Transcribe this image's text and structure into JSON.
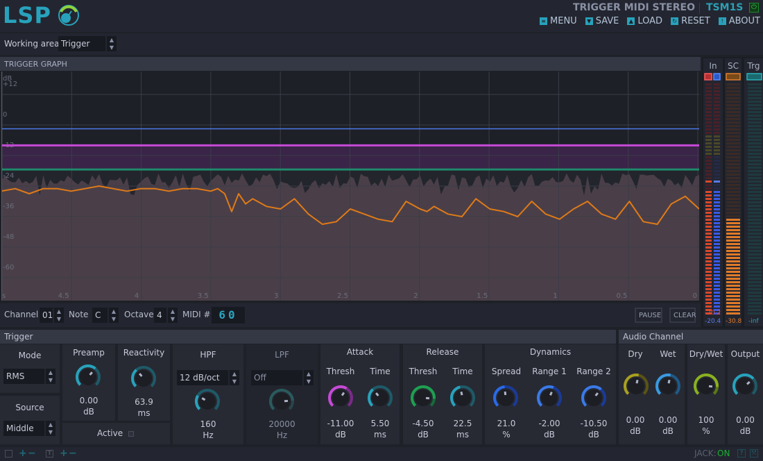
{
  "header": {
    "logo": "LSP",
    "title": "TRIGGER MIDI STEREO",
    "code": "TSM1S",
    "power_icon": "power-icon",
    "menu": [
      {
        "label": "MENU",
        "icon": "menu-icon"
      },
      {
        "label": "SAVE",
        "icon": "save-icon"
      },
      {
        "label": "LOAD",
        "icon": "load-icon"
      },
      {
        "label": "RESET",
        "icon": "reset-icon"
      },
      {
        "label": "ABOUT",
        "icon": "about-icon"
      }
    ]
  },
  "working_area": {
    "label": "Working area",
    "value": "Trigger"
  },
  "graph": {
    "title": "TRIGGER GRAPH",
    "y_unit": "dB",
    "y_ticks": [
      "+12",
      "0",
      "-12",
      "-24",
      "-36",
      "-48",
      "-60"
    ],
    "x_unit": "s",
    "x_ticks": [
      "4.5",
      "4",
      "3.5",
      "3",
      "2.5",
      "2",
      "1.5",
      "1",
      "0.5",
      "0"
    ],
    "colors": {
      "release_line": "#4a78e6",
      "attack_thresh": "#c64ad6",
      "attack_band": "#3a2448",
      "release_thresh": "#1e8a6a",
      "signal": "#e07a18",
      "area": "#4a3f48"
    }
  },
  "chart_data": {
    "type": "line",
    "title": "TRIGGER GRAPH",
    "xlabel": "s",
    "ylabel": "dB",
    "xlim": [
      5,
      0
    ],
    "ylim": [
      -72,
      18
    ],
    "horizontal_lines": [
      {
        "name": "release-level",
        "y": -4.5,
        "color": "#4a78e6"
      },
      {
        "name": "attack-threshold",
        "y": -11,
        "color": "#c64ad6"
      },
      {
        "name": "release-threshold",
        "y": -20.5,
        "color": "#1e8a6a"
      }
    ],
    "series": [
      {
        "name": "envelope",
        "color": "#e07a18",
        "x": [
          5,
          4.9,
          4.8,
          4.7,
          4.6,
          4.5,
          4.4,
          4.3,
          4.2,
          4.1,
          4.0,
          3.9,
          3.8,
          3.7,
          3.6,
          3.5,
          3.45,
          3.4,
          3.35,
          3.3,
          3.25,
          3.2,
          3.1,
          3.0,
          2.9,
          2.8,
          2.7,
          2.6,
          2.5,
          2.4,
          2.3,
          2.2,
          2.1,
          2.0,
          1.95,
          1.9,
          1.8,
          1.7,
          1.6,
          1.5,
          1.4,
          1.3,
          1.2,
          1.1,
          1.0,
          0.9,
          0.8,
          0.7,
          0.6,
          0.5,
          0.4,
          0.3,
          0.2,
          0.1,
          0.0
        ],
        "y": [
          -29,
          -28,
          -30,
          -28,
          -28,
          -29,
          -28,
          -27,
          -28,
          -29,
          -28,
          -28,
          -29,
          -28,
          -28,
          -29,
          -28,
          -30,
          -37,
          -30,
          -34,
          -32,
          -35,
          -36,
          -32,
          -38,
          -42,
          -41,
          -36,
          -38,
          -40,
          -41,
          -33,
          -36,
          -37,
          -35,
          -38,
          -39,
          -32,
          -36,
          -37,
          -39,
          -33,
          -38,
          -40,
          -36,
          -33,
          -38,
          -40,
          -33,
          -41,
          -42,
          -34,
          -31,
          -36
        ]
      },
      {
        "name": "input-signal-peak",
        "color": "#5a4f5c",
        "y_range_db": [
          -22,
          -28
        ]
      }
    ]
  },
  "controls": {
    "channel": {
      "label": "Channel",
      "value": "01"
    },
    "note": {
      "label": "Note",
      "value": "C"
    },
    "octave": {
      "label": "Octave",
      "value": "4"
    },
    "midi": {
      "label": "MIDI #",
      "value": "60"
    },
    "pause": "PAUSE",
    "clear": "CLEAR"
  },
  "meters": {
    "in": {
      "label": "In",
      "left": "-20.2",
      "right": "-20.4",
      "left_level_db": -20.2,
      "right_level_db": -20.4
    },
    "sc": {
      "label": "SC",
      "value": "-30.8",
      "level_db": -30.8
    },
    "trg": {
      "label": "Trg",
      "value": "-inf"
    }
  },
  "trigger": {
    "title": "Trigger",
    "mode": {
      "label": "Mode",
      "value": "RMS"
    },
    "source": {
      "label": "Source",
      "value": "Middle"
    },
    "preamp": {
      "label": "Preamp",
      "value": "0.00",
      "unit": "dB"
    },
    "reactivity": {
      "label": "Reactivity",
      "value": "63.9",
      "unit": "ms"
    },
    "active": {
      "label": "Active"
    },
    "hpf": {
      "label": "HPF",
      "slope": "12 dB/oct",
      "value": "160",
      "unit": "Hz"
    },
    "lpf": {
      "label": "LPF",
      "slope": "Off",
      "value": "20000",
      "unit": "Hz"
    },
    "attack": {
      "label": "Attack",
      "thresh": {
        "label": "Thresh",
        "value": "-11.00",
        "unit": "dB"
      },
      "time": {
        "label": "Time",
        "value": "5.50",
        "unit": "ms"
      }
    },
    "release": {
      "label": "Release",
      "thresh": {
        "label": "Thresh",
        "value": "-4.50",
        "unit": "dB"
      },
      "time": {
        "label": "Time",
        "value": "22.5",
        "unit": "ms"
      }
    },
    "dynamics": {
      "label": "Dynamics",
      "spread": {
        "label": "Spread",
        "value": "21.0",
        "unit": "%"
      },
      "range1": {
        "label": "Range 1",
        "value": "-2.00",
        "unit": "dB"
      },
      "range2": {
        "label": "Range 2",
        "value": "-10.50",
        "unit": "dB"
      }
    }
  },
  "audio": {
    "title": "Audio Channel",
    "dry": {
      "label": "Dry",
      "value": "0.00",
      "unit": "dB"
    },
    "wet": {
      "label": "Wet",
      "value": "0.00",
      "unit": "dB"
    },
    "drywet": {
      "label": "Dry/Wet",
      "value": "100",
      "unit": "%"
    },
    "output": {
      "label": "Output",
      "value": "0.00",
      "unit": "dB"
    }
  },
  "status": {
    "jack_label": "JACK:",
    "jack_value": "ON"
  }
}
